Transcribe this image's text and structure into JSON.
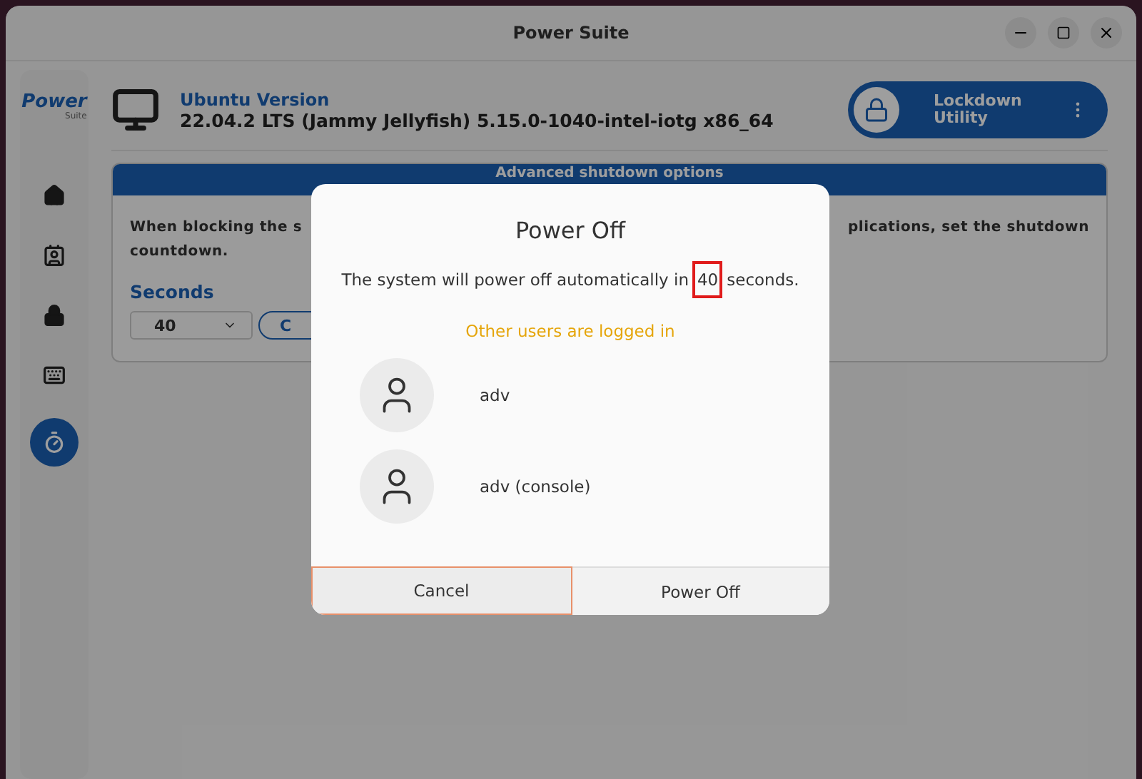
{
  "window": {
    "title": "Power Suite"
  },
  "sidebar": {
    "logo_title": "Power",
    "logo_subtitle": "Suite",
    "items": [
      {
        "kind": "home",
        "selected": false
      },
      {
        "kind": "contact",
        "selected": false
      },
      {
        "kind": "lock",
        "selected": false
      },
      {
        "kind": "keyboard",
        "selected": false
      },
      {
        "kind": "timer",
        "selected": true
      }
    ]
  },
  "header": {
    "version_label": "Ubuntu Version",
    "version_value": "22.04.2 LTS (Jammy Jellyfish) 5.15.0-1040-intel-iotg x86_64",
    "lockdown_button": "Lockdown Utility"
  },
  "card": {
    "title": "Advanced shutdown options",
    "text_left": "When blocking the s",
    "text_right": "plications, set the shutdown",
    "text_continued": "countdown.",
    "seconds_label": "Seconds",
    "seconds_value": "40",
    "button": "C"
  },
  "dialog": {
    "title": "Power Off",
    "message_before": "The system will power off automatically in",
    "message_number": "40",
    "message_after": "seconds.",
    "notice": "Other users are logged in",
    "users": [
      {
        "name": "adv"
      },
      {
        "name": "adv (console)"
      }
    ],
    "buttons": [
      {
        "label": "Cancel",
        "selected": true
      },
      {
        "label": "Power Off",
        "selected": false
      }
    ]
  }
}
